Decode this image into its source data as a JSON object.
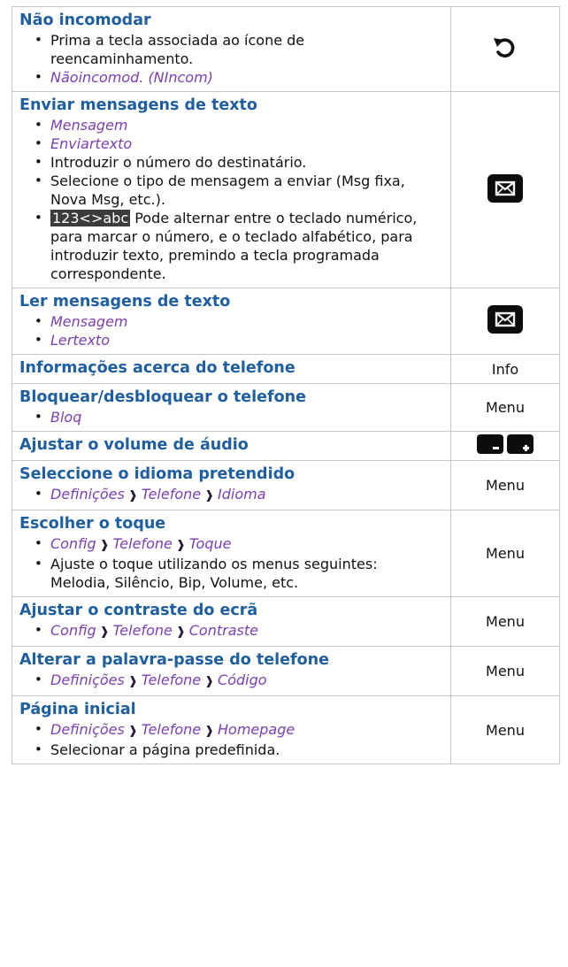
{
  "rows": [
    {
      "title": "Não incomodar",
      "items": [
        {
          "type": "text",
          "text": "Prima a tecla associada ao ícone de reencaminhamento."
        },
        {
          "type": "menu",
          "parts": [
            "Nãoincomod. (NIncom)"
          ]
        }
      ],
      "right": {
        "kind": "icon",
        "icon": "forward-arrow-icon"
      }
    },
    {
      "title": "Enviar mensagens de texto",
      "items": [
        {
          "type": "menu",
          "parts": [
            "Mensagem"
          ]
        },
        {
          "type": "menu",
          "parts": [
            "Enviartexto"
          ]
        },
        {
          "type": "text",
          "text": "Introduzir o número do destinatário."
        },
        {
          "type": "text",
          "text": "Selecione o tipo de mensagem a enviar (Msg fixa, Nova Msg, etc.)."
        },
        {
          "type": "text",
          "highlight": "123<>abc",
          "text": " Pode alternar entre o teclado numérico, para marcar o número, e o teclado alfabético, para introduzir texto, premindo a tecla programada correspondente."
        }
      ],
      "right": {
        "kind": "icon",
        "icon": "envelope-key-icon"
      }
    },
    {
      "title": "Ler mensagens de texto",
      "items": [
        {
          "type": "menu",
          "parts": [
            "Mensagem"
          ]
        },
        {
          "type": "menu",
          "parts": [
            "Lertexto"
          ]
        }
      ],
      "right": {
        "kind": "icon",
        "icon": "envelope-key-icon"
      }
    },
    {
      "title": "Informações acerca do telefone",
      "items": [],
      "right": {
        "kind": "text",
        "text": "Info"
      }
    },
    {
      "title": "Bloquear/desbloquear o telefone",
      "items": [
        {
          "type": "menu",
          "parts": [
            "Bloq"
          ]
        }
      ],
      "right": {
        "kind": "text",
        "text": "Menu"
      }
    },
    {
      "title": "Ajustar o volume de áudio",
      "items": [],
      "right": {
        "kind": "icon",
        "icon": "volume-keys-icon"
      }
    },
    {
      "title": "Seleccione o idioma pretendido",
      "items": [
        {
          "type": "menu",
          "parts": [
            "Definições",
            "Telefone",
            "Idioma"
          ]
        }
      ],
      "right": {
        "kind": "text",
        "text": "Menu"
      }
    },
    {
      "title": "Escolher o toque",
      "items": [
        {
          "type": "menu",
          "parts": [
            "Config",
            "Telefone",
            "Toque"
          ]
        },
        {
          "type": "text",
          "text": "Ajuste o toque utilizando os menus seguintes: Melodia, Silêncio, Bip, Volume, etc."
        }
      ],
      "right": {
        "kind": "text",
        "text": "Menu"
      }
    },
    {
      "title": "Ajustar o contraste do ecrã",
      "items": [
        {
          "type": "menu",
          "parts": [
            "Config",
            "Telefone",
            "Contraste"
          ]
        }
      ],
      "right": {
        "kind": "text",
        "text": "Menu"
      }
    },
    {
      "title": "Alterar a palavra-passe do telefone",
      "items": [
        {
          "type": "menu",
          "parts": [
            "Definições",
            "Telefone",
            "Código"
          ]
        }
      ],
      "right": {
        "kind": "text",
        "text": "Menu"
      }
    },
    {
      "title": "Página inicial",
      "items": [
        {
          "type": "menu",
          "parts": [
            "Definições",
            "Telefone",
            "Homepage"
          ]
        },
        {
          "type": "text",
          "text": "Selecionar a página predefinida."
        }
      ],
      "right": {
        "kind": "text",
        "text": "Menu"
      }
    }
  ]
}
